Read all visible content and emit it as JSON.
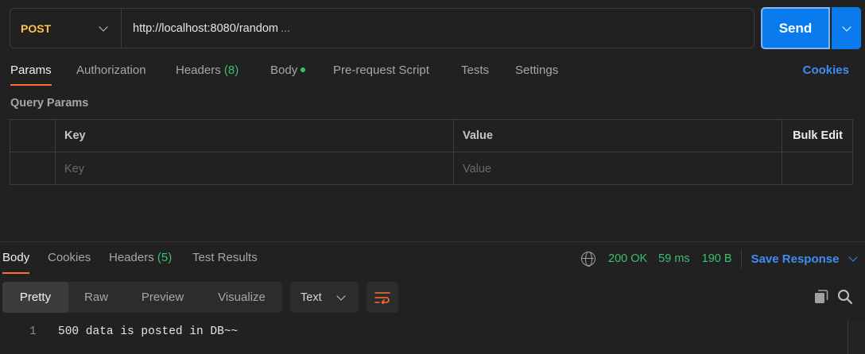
{
  "request": {
    "method": "POST",
    "url": "http://localhost:8080/random",
    "url_overflow": "...",
    "send_label": "Send"
  },
  "request_tabs": {
    "params": "Params",
    "authorization": "Authorization",
    "headers": "Headers",
    "headers_count": "(8)",
    "body": "Body",
    "prerequest": "Pre-request Script",
    "tests": "Tests",
    "settings": "Settings",
    "cookies": "Cookies"
  },
  "query_params": {
    "title": "Query Params",
    "columns": {
      "key": "Key",
      "value": "Value",
      "bulk_edit": "Bulk Edit"
    },
    "placeholders": {
      "key": "Key",
      "value": "Value"
    }
  },
  "response": {
    "tabs": {
      "body": "Body",
      "cookies": "Cookies",
      "headers": "Headers",
      "headers_count": "(5)",
      "test_results": "Test Results"
    },
    "status": "200 OK",
    "time": "59 ms",
    "size": "190 B",
    "save_label": "Save Response",
    "views": [
      "Pretty",
      "Raw",
      "Preview",
      "Visualize"
    ],
    "format": "Text",
    "lines": [
      {
        "number": "1",
        "text": "500 data is posted in DB~~"
      }
    ]
  },
  "colors": {
    "method_post": "#ffc24b",
    "accent_blue": "#097bed",
    "success_green": "#3bbf70",
    "active_tab_underline": "#ff6c37",
    "background": "#212121"
  }
}
